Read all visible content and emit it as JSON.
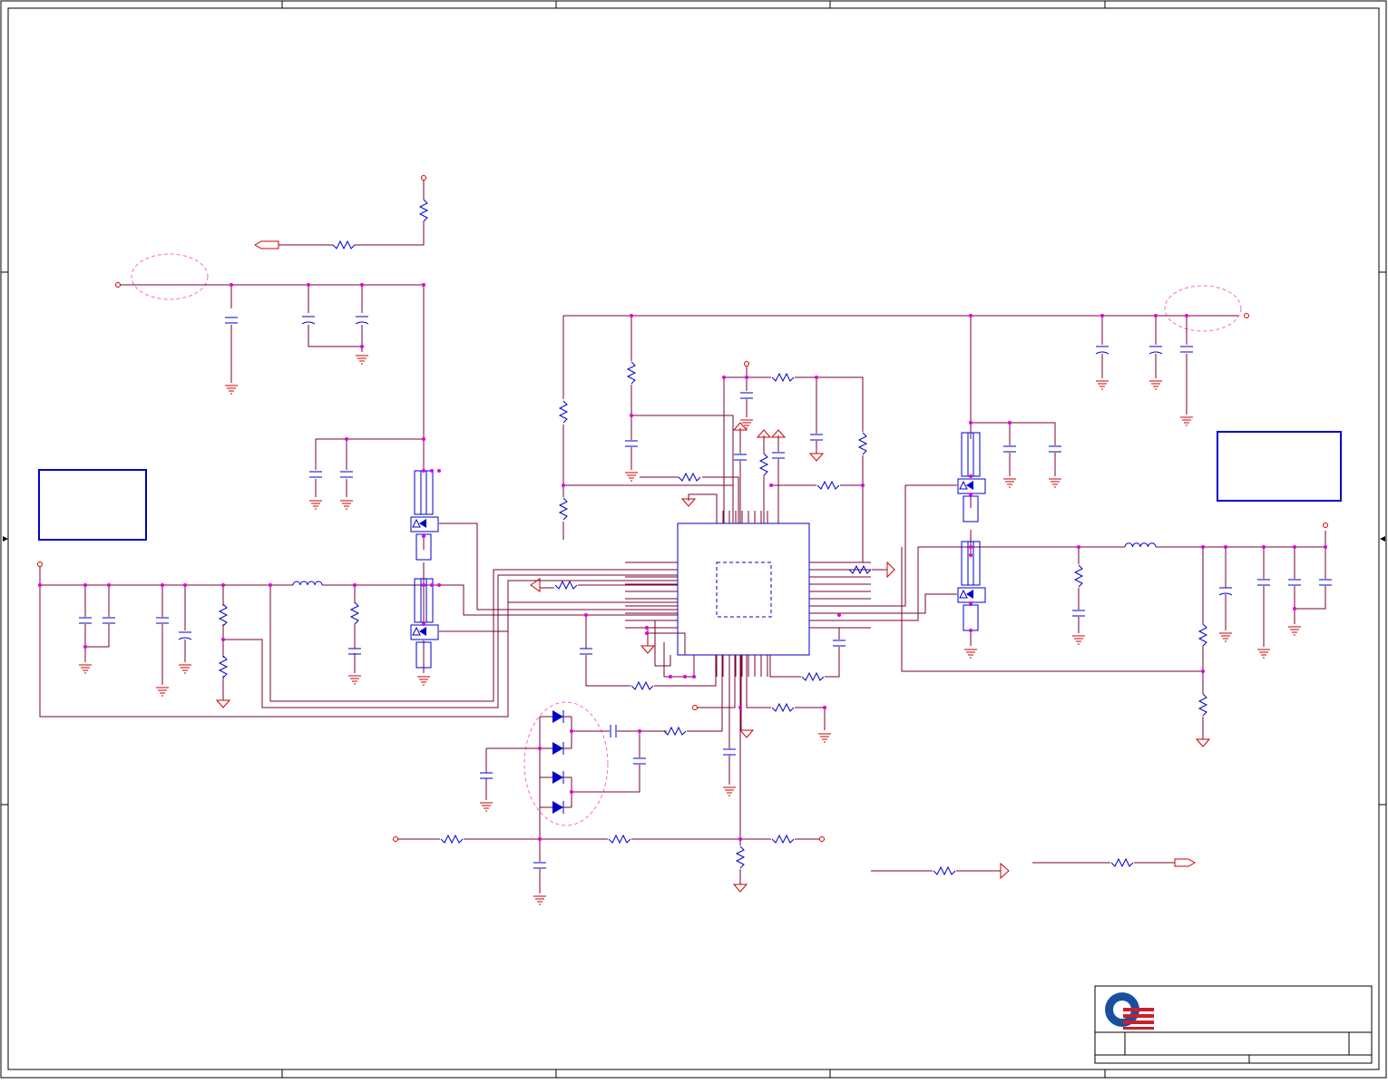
{
  "schematic": {
    "background": "#ffffff",
    "colors": {
      "wire": "#7a0033",
      "pin": "#cc0000",
      "part": "#0000cc",
      "junction": "#e000e0",
      "frame": "#000000",
      "note": "#ff66cc",
      "logo_blue": "#1a4fa0",
      "logo_red": "#cc1f2a"
    },
    "title_block": {
      "logo_icon": "quanta-logo-icon"
    }
  }
}
